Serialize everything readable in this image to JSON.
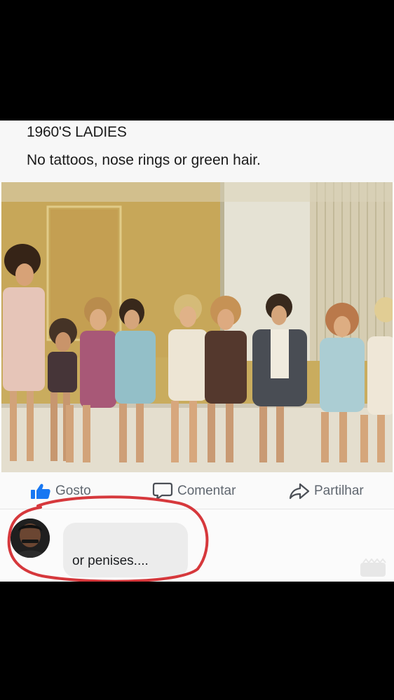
{
  "post": {
    "title": "1960'S LADIES",
    "subtitle": "No tattoos, nose rings or green hair."
  },
  "actions": {
    "like_label": "Gosto",
    "comment_label": "Comentar",
    "share_label": "Partilhar"
  },
  "comment": {
    "author_name": "",
    "text": "or penises...."
  },
  "colors": {
    "like_blue": "#1877f2",
    "ring_red": "#d6383c",
    "action_gray": "#606770"
  },
  "icons": [
    "thumbs-up-icon",
    "speech-bubble-icon",
    "share-arrow-icon",
    "avatar",
    "watermark-icon"
  ]
}
